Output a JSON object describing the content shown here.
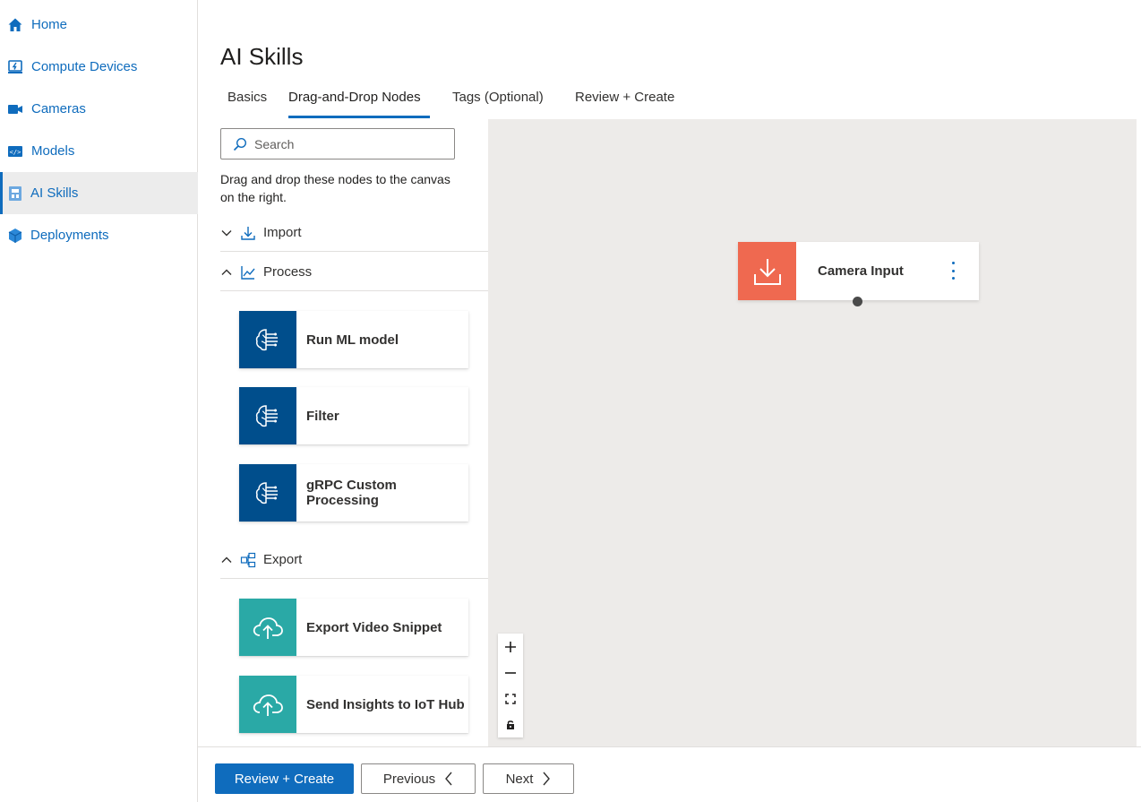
{
  "sidebar": {
    "items": [
      {
        "label": "Home",
        "icon": "home-icon"
      },
      {
        "label": "Compute Devices",
        "icon": "compute-device-icon"
      },
      {
        "label": "Cameras",
        "icon": "camera-icon"
      },
      {
        "label": "Models",
        "icon": "model-icon"
      },
      {
        "label": "AI Skills",
        "icon": "ai-skill-icon",
        "active": true
      },
      {
        "label": "Deployments",
        "icon": "deployment-icon"
      }
    ]
  },
  "page": {
    "title": "AI Skills"
  },
  "tabs": [
    {
      "label": "Basics"
    },
    {
      "label": "Drag-and-Drop Nodes",
      "active": true
    },
    {
      "label": "Tags (Optional)"
    },
    {
      "label": "Review + Create"
    }
  ],
  "panel": {
    "search_placeholder": "Search",
    "instructions": "Drag and drop these nodes to the canvas on the right.",
    "sections": {
      "import": {
        "label": "Import",
        "expanded": false
      },
      "process": {
        "label": "Process",
        "expanded": true
      },
      "export": {
        "label": "Export",
        "expanded": true
      }
    },
    "process_nodes": [
      {
        "label": "Run ML model",
        "icon": "brain-circuit-icon"
      },
      {
        "label": "Filter",
        "icon": "brain-circuit-icon"
      },
      {
        "label": "gRPC Custom Processing",
        "icon": "brain-circuit-icon"
      }
    ],
    "export_nodes": [
      {
        "label": "Export Video Snippet",
        "icon": "cloud-upload-icon"
      },
      {
        "label": "Send Insights to IoT Hub",
        "icon": "cloud-upload-icon"
      }
    ]
  },
  "canvas": {
    "node": {
      "label": "Camera Input",
      "icon": "download-icon"
    }
  },
  "footer": {
    "review_create": "Review + Create",
    "previous": "Previous",
    "next": "Next"
  },
  "colors": {
    "accent": "#0f6cbd",
    "process_node": "#004e8c",
    "export_node": "#2aa9a6",
    "camera_input_node": "#ef6950",
    "canvas_bg": "#edebe9"
  }
}
